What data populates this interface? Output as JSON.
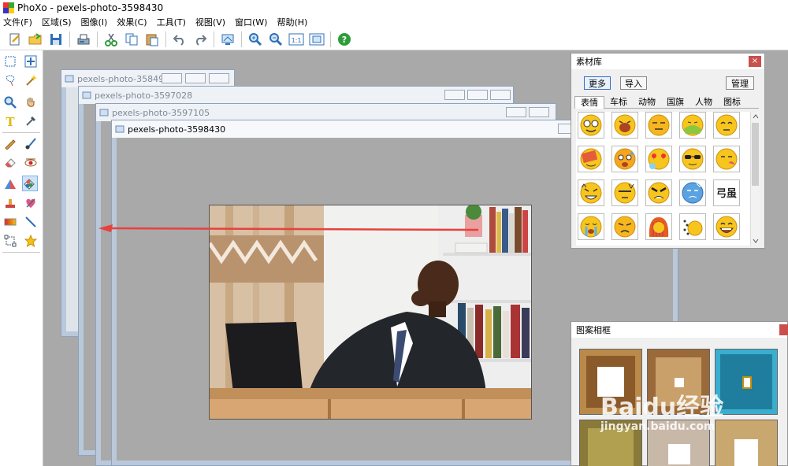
{
  "window": {
    "title": "PhoXo - pexels-photo-3598430"
  },
  "menu": [
    "文件(F)",
    "区域(S)",
    "图像(I)",
    "效果(C)",
    "工具(T)",
    "视图(V)",
    "窗口(W)",
    "帮助(H)"
  ],
  "toolbar": {
    "buttons": [
      "new-icon",
      "open-icon",
      "save-icon",
      "scan-icon",
      "cut-icon",
      "copy-icon",
      "paste-icon",
      "undo-icon",
      "redo-icon",
      "screen-capture-icon",
      "zoom-in-icon",
      "zoom-out-icon",
      "actual-size-icon",
      "fit-window-icon",
      "help-icon"
    ],
    "actual_size_label": "1:1"
  },
  "documents": [
    {
      "title": "pexels-photo-35849..."
    },
    {
      "title": "pexels-photo-3597028"
    },
    {
      "title": "pexels-photo-3597105"
    },
    {
      "title": "pexels-photo-3598430"
    }
  ],
  "materials_panel": {
    "title": "素材库",
    "more_button": "更多",
    "import_button": "导入",
    "manage_button": "管理",
    "tabs": [
      "表情",
      "车标",
      "动物",
      "国旗",
      "人物",
      "图标"
    ],
    "active_tab": "表情",
    "close": "×",
    "emoticon_text": "弓虽"
  },
  "frames_panel": {
    "title": "图案相框"
  },
  "watermark": {
    "line1": "Bai",
    "paw": "du",
    "line1b": "经验",
    "line2": "jingyan.baidu.com"
  },
  "colors": {
    "accent": "#3a6fc3",
    "arrow": "#e8413c",
    "workspace": "#a9a9a9",
    "close": "#c9504c"
  }
}
